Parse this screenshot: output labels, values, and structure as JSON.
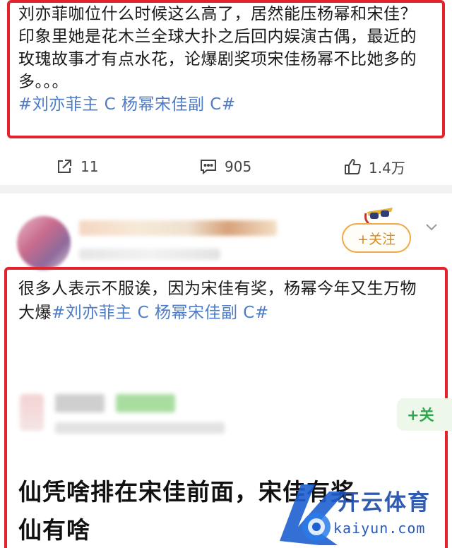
{
  "post1": {
    "text": "刘亦菲咖位什么时候这么高了，居然能压杨幂和宋佳？印象里她是花木兰全球大扑之后回内娱演古偶，最近的玫瑰故事才有点水花，论爆剧奖项宋佳杨幂不比她多的多。。。",
    "hashtag": "#刘亦菲主 C 杨幂宋佳副 C#"
  },
  "actions": {
    "repost_count": "11",
    "comment_count": "905",
    "like_count": "1.4万",
    "repost_icon": "share-icon",
    "comment_icon": "comment-icon",
    "like_icon": "thumbs-up-icon"
  },
  "post2": {
    "follow_label": "+关注",
    "text": "很多人表示不服诶，因为宋佳有奖，杨幂今年又生万物大爆",
    "hashtag": "#刘亦菲主 C 杨幂宋佳副 C#",
    "inner_follow_label": "+关",
    "big_text_line1": "仙凭啥排在宋佳前面，宋佳有奖",
    "big_text_line2": "仙有啥"
  },
  "watermark": {
    "cn": "开云体育",
    "en": "kaiyun.com"
  },
  "colors": {
    "highlight_border": "#e2232a",
    "hashtag": "#4f7cc6",
    "follow_orange": "#f0a94a",
    "follow_green": "#2da84d"
  }
}
